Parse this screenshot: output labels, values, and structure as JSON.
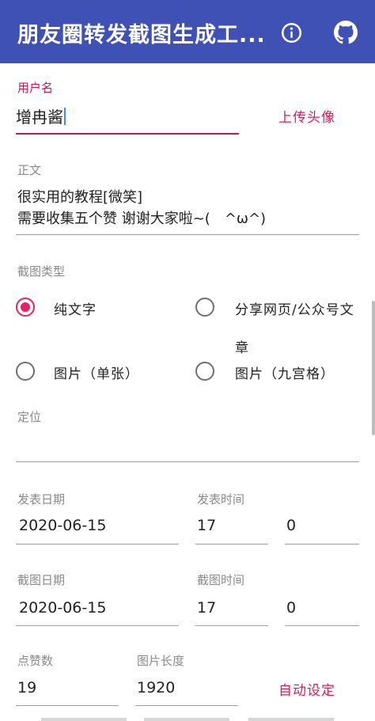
{
  "appbar": {
    "title": "朋友圈转发截图生成工...",
    "info_icon": "info-icon",
    "github_icon": "github-icon",
    "background": "#3f51b5"
  },
  "form": {
    "username": {
      "label": "用户名",
      "value": "增冉酱"
    },
    "upload_avatar": "上传头像",
    "body": {
      "label": "正文",
      "line1": "很实用的教程[微笑]",
      "line2": "需要收集五个赞 谢谢大家啦~(　^ω^)"
    },
    "screenshot_type": {
      "label": "截图类型",
      "options": [
        {
          "label": "纯文字",
          "checked": true
        },
        {
          "label": "分享网页/公众号文",
          "label_cont": "章",
          "checked": false
        },
        {
          "label": "图片（单张）",
          "checked": false
        },
        {
          "label": "图片（九宫格）",
          "checked": false
        }
      ]
    },
    "location": {
      "label": "定位",
      "value": ""
    },
    "post_date": {
      "label": "发表日期",
      "value": "2020-06-15"
    },
    "post_time": {
      "label": "发表时间",
      "hour": "17",
      "minute": "0"
    },
    "shot_date": {
      "label": "截图日期",
      "value": "2020-06-15"
    },
    "shot_time": {
      "label": "截图时间",
      "hour": "17",
      "minute": "0"
    },
    "likes": {
      "label": "点赞数",
      "value": "19"
    },
    "image_length": {
      "label": "图片长度",
      "value": "1920"
    },
    "auto_set": "自动设定"
  },
  "colors": {
    "accent": "#e91e63",
    "accent_text": "#c2185b",
    "primary": "#3f51b5"
  }
}
